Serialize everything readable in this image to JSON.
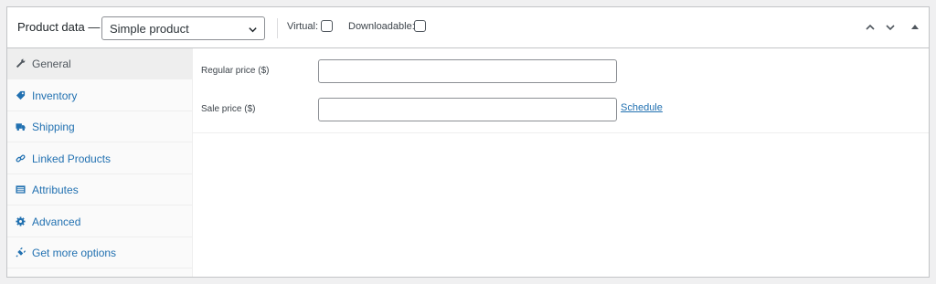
{
  "header": {
    "title": "Product data —",
    "product_type": {
      "selected": "Simple product",
      "icon": "chevron-down-icon"
    },
    "virtual_label": "Virtual:",
    "downloadable_label": "Downloadable:",
    "controls": [
      "move-up-icon",
      "move-down-icon",
      "collapse-icon"
    ]
  },
  "tabs": [
    {
      "label": "General",
      "icon": "wrench-icon",
      "active": true
    },
    {
      "label": "Inventory",
      "icon": "tag-icon",
      "active": false
    },
    {
      "label": "Shipping",
      "icon": "truck-icon",
      "active": false
    },
    {
      "label": "Linked Products",
      "icon": "link-icon",
      "active": false
    },
    {
      "label": "Attributes",
      "icon": "list-icon",
      "active": false
    },
    {
      "label": "Advanced",
      "icon": "gear-icon",
      "active": false
    },
    {
      "label": "Get more options",
      "icon": "plugin-icon",
      "active": false
    }
  ],
  "general": {
    "regular_price_label": "Regular price ($)",
    "regular_price_value": "",
    "sale_price_label": "Sale price ($)",
    "sale_price_value": "",
    "schedule_link": "Schedule"
  },
  "colors": {
    "link": "#2271b1",
    "border": "#c3c4c7",
    "active_tab_bg": "#eeeeee"
  }
}
